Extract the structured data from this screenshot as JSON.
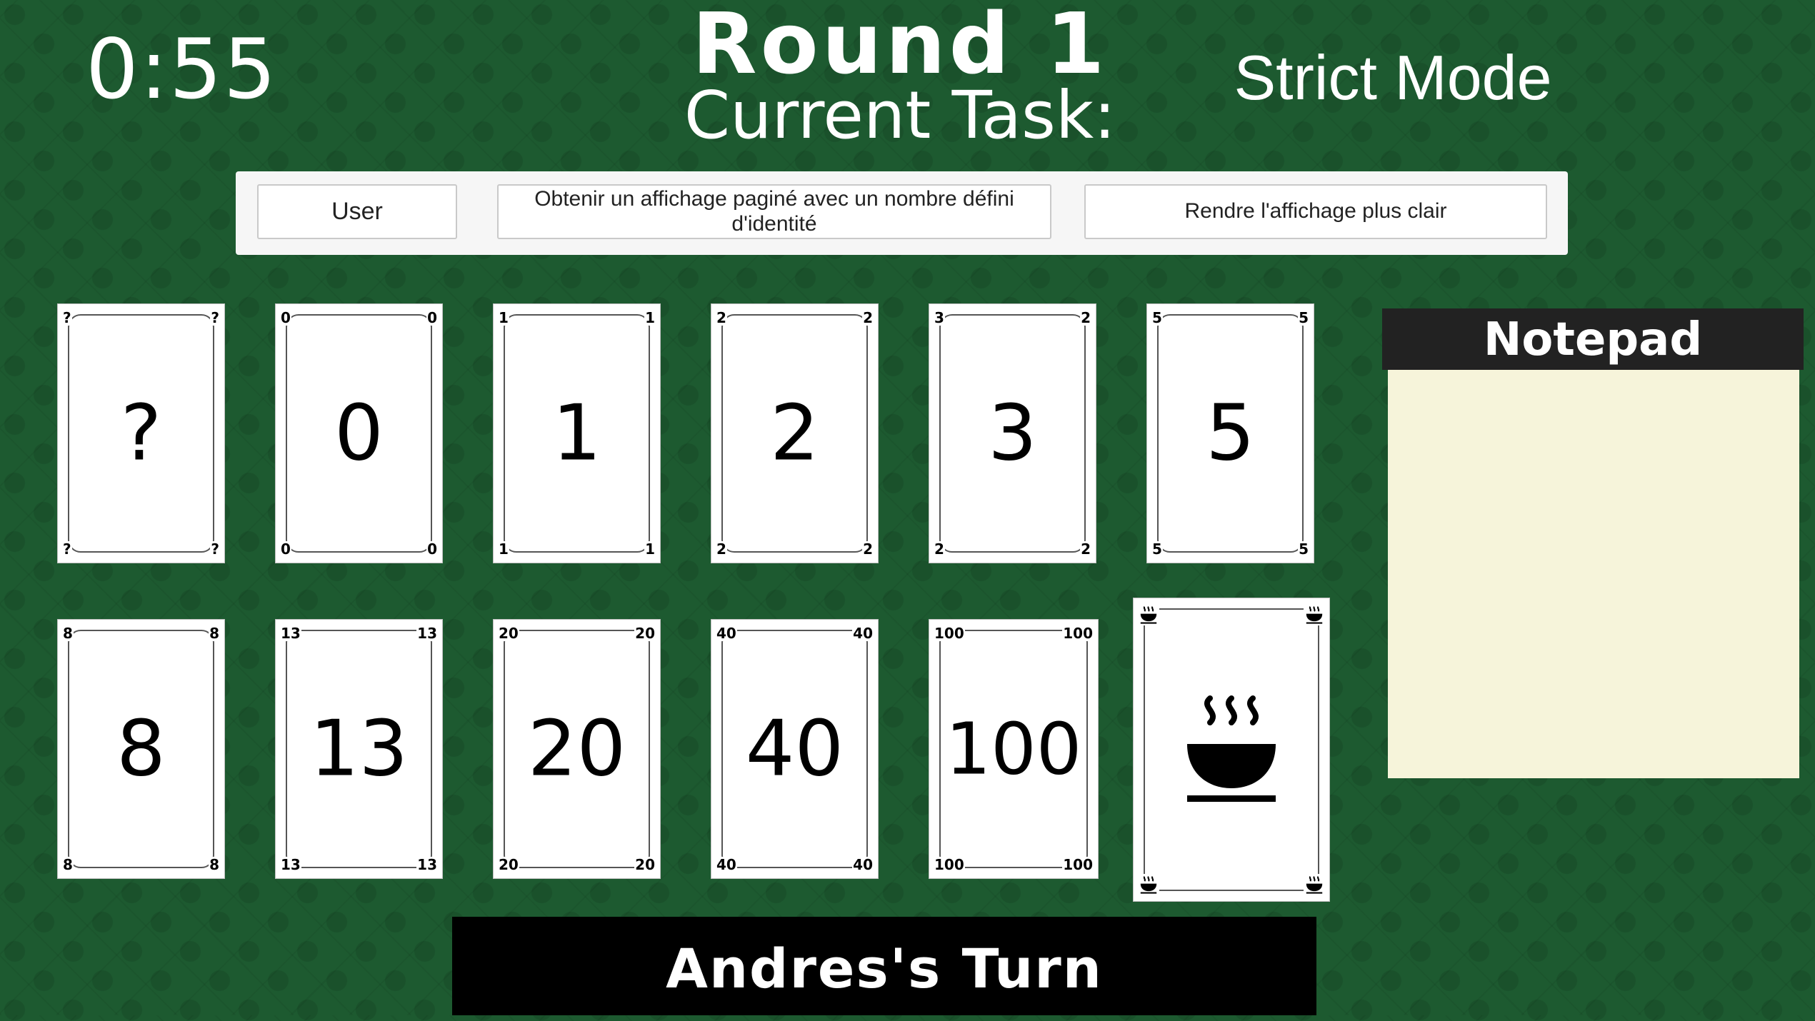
{
  "timer": "0:55",
  "round_title": "Round 1",
  "task_label": "Current Task:",
  "mode": "Strict Mode",
  "task": {
    "user": "User",
    "description": "Obtenir un affichage paginé avec un nombre défini d'identité",
    "goal": "Rendre l'affichage plus clair"
  },
  "cards": [
    {
      "value": "?"
    },
    {
      "value": "0"
    },
    {
      "value": "1"
    },
    {
      "value": "2"
    },
    {
      "value": "3"
    },
    {
      "value": "5"
    },
    {
      "value": "8"
    },
    {
      "value": "13"
    },
    {
      "value": "20"
    },
    {
      "value": "40"
    },
    {
      "value": "100"
    },
    {
      "value": "",
      "icon": "coffee-cup-icon"
    }
  ],
  "card_corners": {
    "card_3": {
      "tl": "3",
      "tr": "2",
      "bl": "2",
      "br": "2"
    }
  },
  "notepad": {
    "title": "Notepad",
    "content": ""
  },
  "turn": "Andres's Turn",
  "colors": {
    "table_green": "#1d5a30",
    "notepad_paper": "#f6f4da",
    "notepad_header": "#222222",
    "banner": "#000000"
  }
}
